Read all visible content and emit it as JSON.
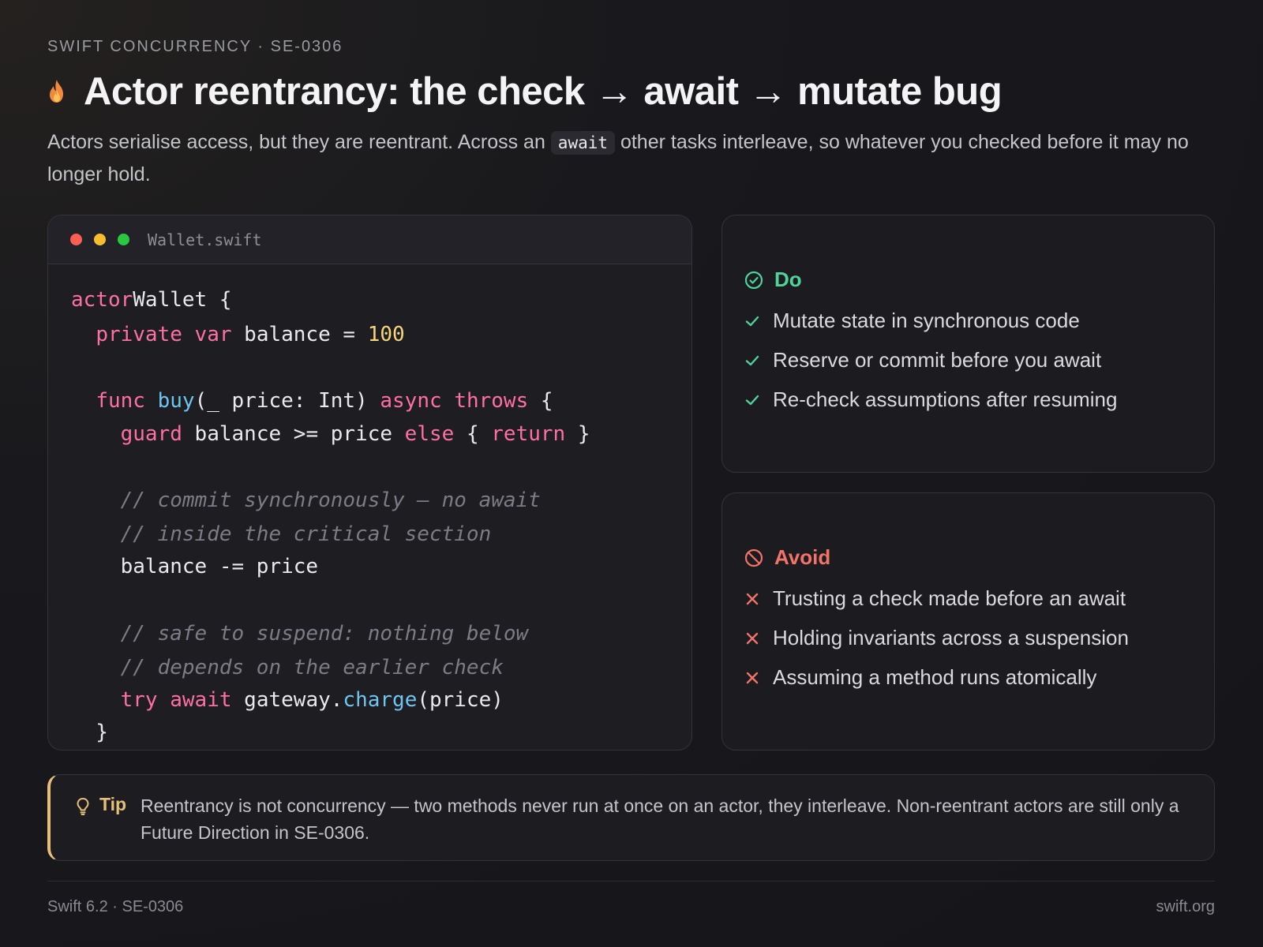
{
  "header": {
    "eyebrow": "SWIFT CONCURRENCY · SE-0306",
    "title": "Actor reentrancy: the check → await → mutate bug",
    "fire_icon": "fire-icon",
    "lead_before": "Actors serialise access, but they are reentrant. Across an ",
    "lead_code": "await",
    "lead_after": " other tasks interleave, so whatever you checked before it may no longer hold."
  },
  "code": {
    "filename": "Wallet.swift",
    "window_dots": [
      "#fd5f57",
      "#fcbc2e",
      "#28c840"
    ],
    "lines": [
      [
        [
          "kw",
          "actor"
        ],
        [
          "",
          "Wallet {"
        ]
      ],
      [
        [
          "",
          "  "
        ],
        [
          "kw",
          "private"
        ],
        [
          "",
          ""
        ],
        [
          "kw",
          " var"
        ],
        [
          "",
          " balance = "
        ],
        [
          "num",
          "100"
        ]
      ],
      [],
      [
        [
          "",
          "  "
        ],
        [
          "kw",
          "func"
        ],
        [
          "",
          " "
        ],
        [
          "fn",
          "buy"
        ],
        [
          "",
          "(_ price: Int) "
        ],
        [
          "kw",
          "async"
        ],
        [
          "",
          " "
        ],
        [
          "kw",
          "throws"
        ],
        [
          "",
          " {"
        ]
      ],
      [
        [
          "",
          "    "
        ],
        [
          "kw",
          "guard"
        ],
        [
          "",
          " balance >= price "
        ],
        [
          "kw",
          "else"
        ],
        [
          "",
          " { "
        ],
        [
          "kw",
          "return"
        ],
        [
          "",
          " }"
        ]
      ],
      [],
      [
        [
          "",
          "    "
        ],
        [
          "cm",
          "// commit synchronously — no await"
        ]
      ],
      [
        [
          "",
          "    "
        ],
        [
          "cm",
          "// inside the critical section"
        ]
      ],
      [
        [
          "",
          "    balance -= price"
        ]
      ],
      [],
      [
        [
          "",
          "    "
        ],
        [
          "cm",
          "// safe to suspend: nothing below"
        ]
      ],
      [
        [
          "",
          "    "
        ],
        [
          "cm",
          "// depends on the earlier check"
        ]
      ],
      [
        [
          "",
          "    "
        ],
        [
          "kw",
          "try"
        ],
        [
          "",
          " "
        ],
        [
          "kw",
          "await"
        ],
        [
          "",
          " gateway."
        ],
        [
          "fn",
          "charge"
        ],
        [
          "",
          "(price)"
        ]
      ],
      [
        [
          "",
          "  }"
        ]
      ]
    ]
  },
  "do_panel": {
    "heading": "Do",
    "icon": "check-circle-icon",
    "color": "#4fd39a",
    "items": [
      "Mutate state in synchronous code",
      "Reserve or commit before you await",
      "Re-check assumptions after resuming"
    ]
  },
  "avoid_panel": {
    "heading": "Avoid",
    "icon": "prohibited-icon",
    "color": "#f27468",
    "items": [
      "Trusting a check made before an await",
      "Holding invariants across a suspension",
      "Assuming a method runs atomically"
    ]
  },
  "tip": {
    "label": "Tip",
    "icon": "lightbulb-icon",
    "text": "Reentrancy is not concurrency — two methods never run at once on an actor, they interleave. Non-reentrant actors are still only a Future Direction in SE-0306."
  },
  "footer": {
    "left": "Swift 6.2 · SE-0306",
    "right": "swift.org"
  }
}
